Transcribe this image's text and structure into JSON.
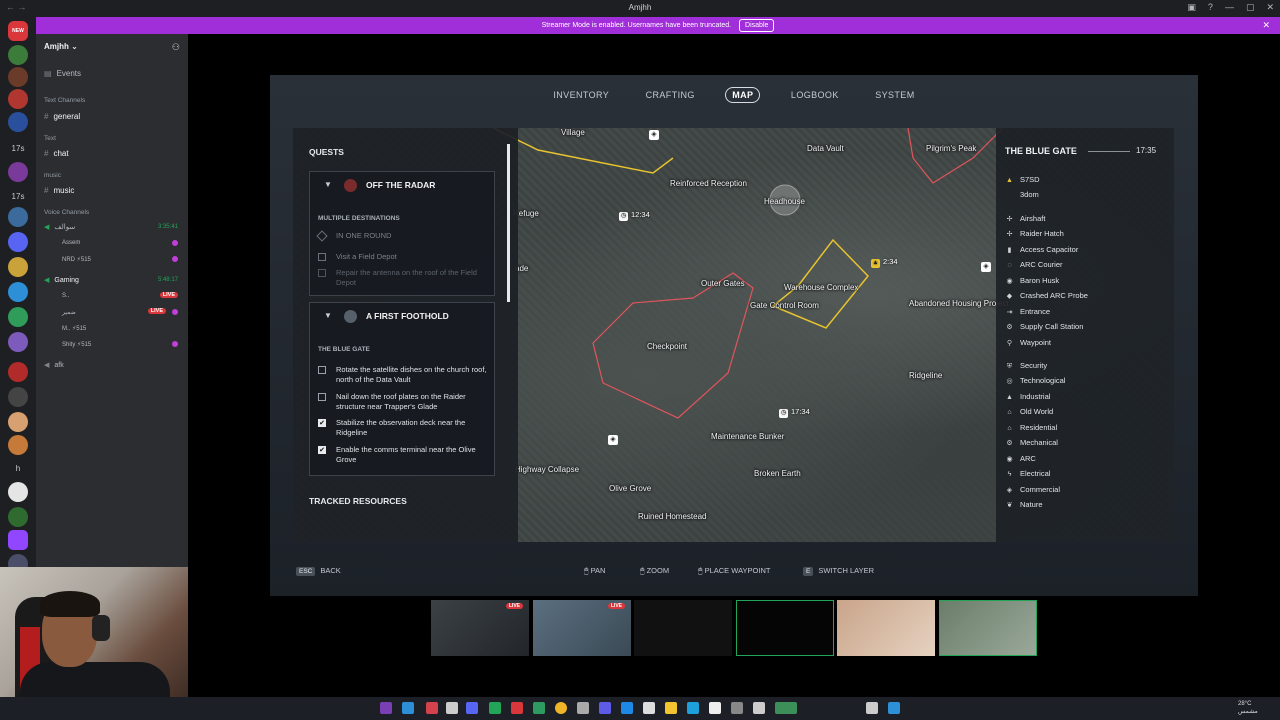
{
  "window": {
    "title": "Amjhh"
  },
  "banner": {
    "text": "Streamer Mode is enabled. Usernames have been truncated.",
    "disable_label": "Disable",
    "close": "✕"
  },
  "server": {
    "name": "Amjhh",
    "events_label": "Events",
    "categories": {
      "text_channels": "Text Channels",
      "text": "Text",
      "music": "music",
      "voice_channels": "Voice Channels"
    },
    "channels": {
      "general": "general",
      "chat": "chat",
      "music": "music"
    },
    "voice": {
      "ch1": {
        "name": "سوالف",
        "time": "3:35:41"
      },
      "ch1_users": [
        "Assem",
        "NRD"
      ],
      "gaming": {
        "name": "Gaming",
        "time": "5:48:17"
      },
      "gaming_users": [
        "S..",
        "ضمير",
        "M..",
        "Shity"
      ],
      "afk": "afk"
    },
    "live_label": "LIVE",
    "badge_515": "⚡515"
  },
  "server_rail": {
    "new_badge": "NEW",
    "labels": [
      "17s",
      "17s",
      "h"
    ]
  },
  "game": {
    "tabs": [
      {
        "label": "INVENTORY"
      },
      {
        "label": "CRAFTING"
      },
      {
        "label": "MAP"
      },
      {
        "label": "LOGBOOK"
      },
      {
        "label": "SYSTEM"
      }
    ],
    "quests_title": "QUESTS",
    "tracked_title": "TRACKED RESOURCES",
    "quest1": {
      "name": "OFF THE RADAR",
      "subheading": "MULTIPLE DESTINATIONS",
      "option": "IN ONE ROUND",
      "items": [
        "Visit a Field Depot",
        "Repair the antenna on the roof of the Field Depot"
      ]
    },
    "quest2": {
      "name": "A FIRST FOOTHOLD",
      "subheading": "THE BLUE GATE",
      "items": [
        {
          "text": "Rotate the satellite dishes on the church roof, north of the Data Vault",
          "checked": false
        },
        {
          "text": "Nail down the roof plates on the Raider structure near Trapper's Glade",
          "checked": false
        },
        {
          "text": "Stabilize the observation deck near the Ridgeline",
          "checked": true
        },
        {
          "text": "Enable the comms terminal near the Olive Grove",
          "checked": true
        }
      ]
    },
    "map_labels": {
      "village": "Village",
      "data_vault": "Data Vault",
      "pilgrims_peak": "Pilgrim's Peak",
      "reinforced_reception": "Reinforced Reception",
      "headhouse": "Headhouse",
      "refuge": "Refuge",
      "glade": "ade",
      "outer_gates": "Outer Gates",
      "warehouse_complex": "Warehouse Complex",
      "gate_control_room": "Gate Control Room",
      "abandoned_housing": "Abandoned Housing Project",
      "checkpoint": "Checkpoint",
      "ridgeline": "Ridgeline",
      "maintenance_bunker": "Maintenance Bunker",
      "broken_earth": "Broken Earth",
      "highway_collapse": "Highway Collapse",
      "olive_grove": "Olive Grove",
      "ruined_homestead": "Ruined Homestead"
    },
    "timers": [
      "12:34",
      "17:34",
      "2:34"
    ],
    "legend": {
      "map_name": "THE BLUE GATE",
      "time": "17:35",
      "players": [
        "S7SD",
        "3dom"
      ],
      "poi": [
        "Airshaft",
        "Raider Hatch",
        "Access Capacitor",
        "ARC Courier",
        "Baron Husk",
        "Crashed ARC Probe",
        "Entrance",
        "Supply Call Station",
        "Waypoint"
      ],
      "zones": [
        "Security",
        "Technological",
        "Industrial",
        "Old World",
        "Residential",
        "Mechanical",
        "ARC",
        "Electrical",
        "Commercial",
        "Nature"
      ]
    },
    "hints": {
      "esc_key": "ESC",
      "back": "BACK",
      "pan": "PAN",
      "zoom": "ZOOM",
      "place_waypoint": "PLACE WAYPOINT",
      "e_key": "E",
      "switch_layer": "SWITCH LAYER"
    }
  },
  "taskbar": {
    "temp": "28°C",
    "weather": "مشمس",
    "time": "",
    "date": ""
  }
}
